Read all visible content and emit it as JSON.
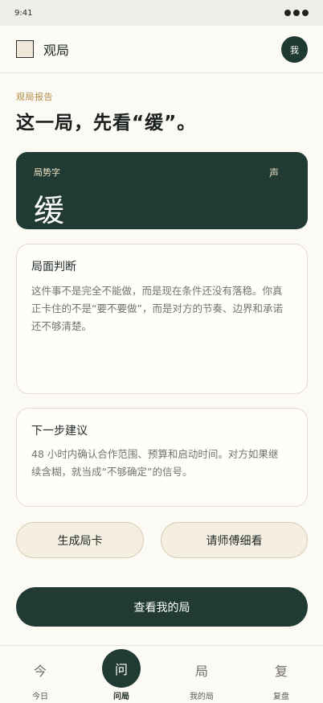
{
  "status": {
    "time": "9:41"
  },
  "header": {
    "app_title": "观局",
    "avatar_text": "我"
  },
  "report": {
    "kicker": "观局报告",
    "headline": "这一局，先看“缓”。"
  },
  "situation": {
    "label": "局势字",
    "character": "缓",
    "sound_label": "声"
  },
  "assessment": {
    "title": "局面判断",
    "body": "这件事不是完全不能做，而是现在条件还没有落稳。你真正卡住的不是“要不要做”，而是对方的节奏、边界和承诺还不够清楚。"
  },
  "advice": {
    "title": "下一步建议",
    "body": "48 小时内确认合作范围、预算和启动时间。对方如果继续含糊，就当成“不够确定”的信号。"
  },
  "actions": {
    "generate_card": "生成局卡",
    "ask_master": "请师傅细看",
    "view_mine": "查看我的局"
  },
  "tabs": [
    {
      "icon": "今",
      "label": "今日",
      "active": false
    },
    {
      "icon": "问",
      "label": "问局",
      "active": true
    },
    {
      "icon": "局",
      "label": "我的局",
      "active": false
    },
    {
      "icon": "复",
      "label": "复盘",
      "active": false
    }
  ]
}
